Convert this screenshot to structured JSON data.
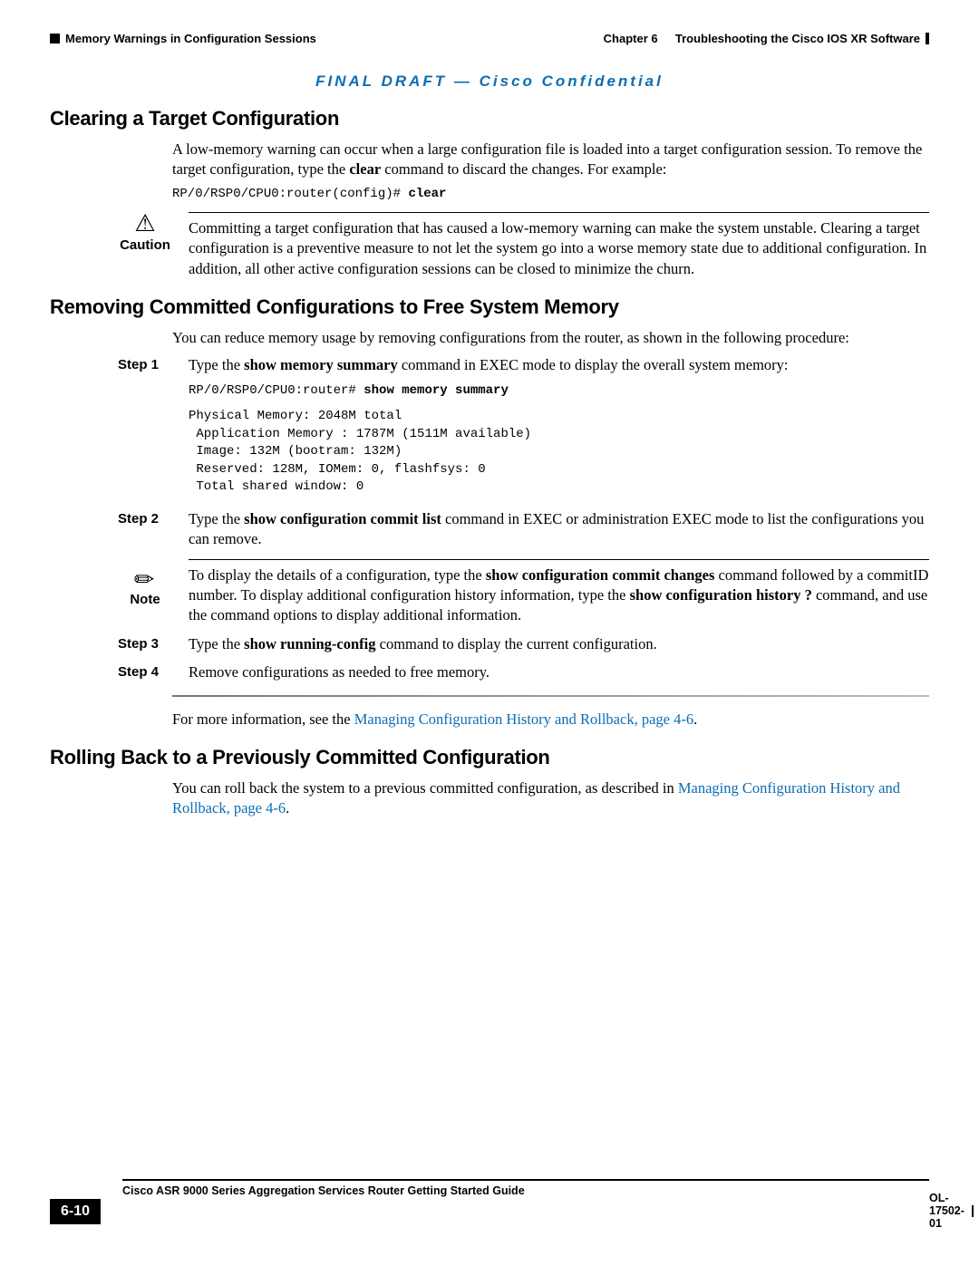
{
  "header": {
    "left_marker_label": "Memory Warnings in Configuration Sessions",
    "right_chapter_prefix": "Chapter 6",
    "right_chapter_title": "Troubleshooting the Cisco IOS XR Software"
  },
  "banner": "FINAL DRAFT — Cisco Confidential",
  "section1": {
    "title": "Clearing a Target Configuration",
    "para1_a": "A low-memory warning can occur when a large configuration file is loaded into a target configuration session. To remove the target configuration, type the ",
    "para1_cmd": "clear",
    "para1_b": " command to discard the changes. For example:",
    "code_prompt": "RP/0/RSP0/CPU0:router(config)# ",
    "code_cmd": "clear"
  },
  "caution": {
    "label": "Caution",
    "text": "Committing a target configuration that has caused a low-memory warning can make the system unstable. Clearing a target configuration is a preventive measure to not let the system go into a worse memory state due to additional configuration. In addition, all other active configuration sessions can be closed to minimize the churn."
  },
  "section2": {
    "title": "Removing Committed Configurations to Free System Memory",
    "intro": "You can reduce memory usage by removing configurations from the router, as shown in the following procedure:",
    "step1": {
      "label": "Step 1",
      "text_a": "Type the ",
      "cmd": "show memory summary",
      "text_b": " command in EXEC mode to display the overall system memory:",
      "code_prompt": "RP/0/RSP0/CPU0:router# ",
      "code_cmd": "show memory summary",
      "output": "Physical Memory: 2048M total\n Application Memory : 1787M (1511M available)\n Image: 132M (bootram: 132M)\n Reserved: 128M, IOMem: 0, flashfsys: 0\n Total shared window: 0"
    },
    "step2": {
      "label": "Step 2",
      "text_a": "Type the ",
      "cmd": "show configuration commit list",
      "text_b": " command in EXEC or administration EXEC mode to list the configurations you can remove."
    },
    "note": {
      "label": "Note",
      "text_a": "To display the details of a configuration, type the ",
      "cmd1": "show configuration commit changes",
      "text_b": " command followed by a commitID number. To display additional configuration history information, type the ",
      "cmd2": "show configuration history ?",
      "text_c": " command, and use the command options to display additional information."
    },
    "step3": {
      "label": "Step 3",
      "text_a": "Type the ",
      "cmd": "show running-config",
      "text_b": " command to display the current configuration."
    },
    "step4": {
      "label": "Step 4",
      "text": "Remove configurations as needed to free memory."
    },
    "more_info_a": "For more information, see the ",
    "more_info_link": "Managing Configuration History and Rollback, page 4-6",
    "more_info_b": "."
  },
  "section3": {
    "title": "Rolling Back to a Previously Committed Configuration",
    "text_a": "You can roll back the system to a previous committed configuration, as described in ",
    "link": "Managing Configuration History and Rollback, page 4-6",
    "text_b": "."
  },
  "footer": {
    "guide_title": "Cisco ASR 9000 Series Aggregation Services Router Getting Started Guide",
    "page_number": "6-10",
    "doc_id": "OL-17502-01"
  }
}
